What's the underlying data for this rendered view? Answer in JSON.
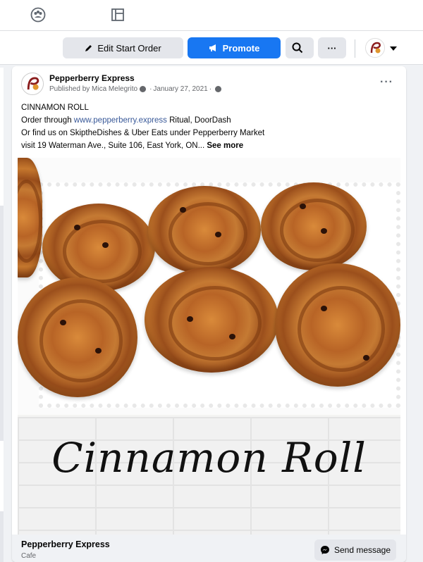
{
  "topnav": {
    "icons": [
      "community-icon",
      "pages-icon"
    ]
  },
  "actionbar": {
    "edit_start_order": "Edit Start Order",
    "promote": "Promote",
    "search_icon": "search-icon",
    "more": "···"
  },
  "post": {
    "page_name": "Pepperberry Express",
    "published_by": "Published by Mica Melegrito",
    "date": "January 27, 2021",
    "more": "···",
    "line1": "CINNAMON ROLL",
    "line2_prefix": "Order through ",
    "link": "www.pepperberry.express",
    "line2_suffix": " Ritual, DoorDash",
    "line3": "Or find us on SkiptheDishes & Uber Eats under Pepperberry Market",
    "line4": "visit 19 Waterman Ave., Suite 106, East York, ON...",
    "see_more": "See more",
    "image_caption": "Cinnamon Roll"
  },
  "footer": {
    "page_name": "Pepperberry Express",
    "category": "Cafe",
    "send_message": "Send message"
  },
  "colors": {
    "brand_blue": "#1877f2",
    "link": "#385898",
    "background": "#f0f2f5"
  }
}
